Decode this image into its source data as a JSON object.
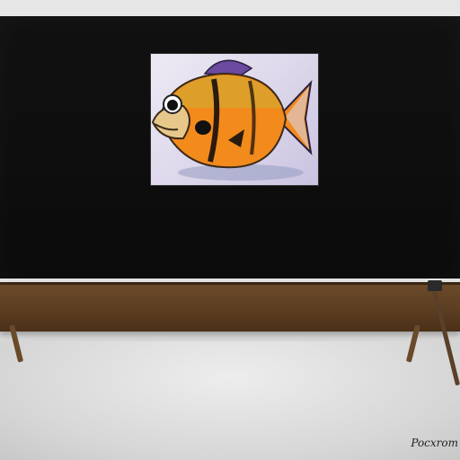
{
  "image": {
    "subject": "television",
    "artwork_subject": "fish"
  },
  "watermark": {
    "text": "Pocxrom"
  },
  "colors": {
    "screen": "#0e0e0e",
    "console_wood": "#5a3c20",
    "fish_body": "#f28a1c",
    "fish_fin": "#6b4aa0"
  }
}
